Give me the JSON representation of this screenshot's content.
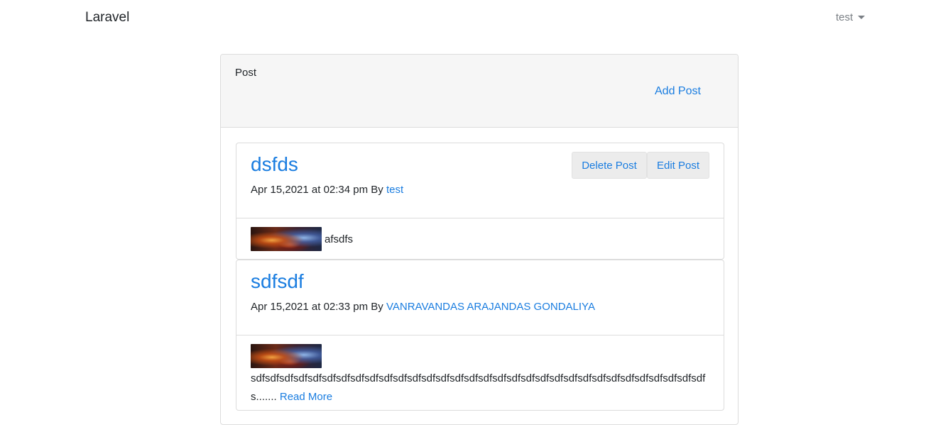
{
  "navbar": {
    "brand": "Laravel",
    "user": "test"
  },
  "card": {
    "title": "Post",
    "add_post_label": "Add Post"
  },
  "posts": [
    {
      "title": "dsfds",
      "date": "Apr 15,2021 at 02:34 pm",
      "by_label": "By",
      "author": "test",
      "excerpt": "afsdfs",
      "delete_label": "Delete Post",
      "edit_label": "Edit Post"
    },
    {
      "title": "sdfsdf",
      "date": "Apr 15,2021 at 02:33 pm",
      "by_label": "By",
      "author": "VANRAVANDAS ARAJANDAS GONDALIYA",
      "excerpt": "sdfsdfsdfsdfsdfsdfsdfsdfsdfsdfsdfsdfsdfsdfsdfsdfsdfsdfsdfsdfsdfsdfsdfsdfsdfsdfsdfsdfsdfsdfsdfsdfs.......",
      "read_more_label": "Read More"
    }
  ],
  "colors": {
    "link": "#1a7de0",
    "border": "#dcdcdc",
    "header_bg": "#f6f6f6"
  }
}
